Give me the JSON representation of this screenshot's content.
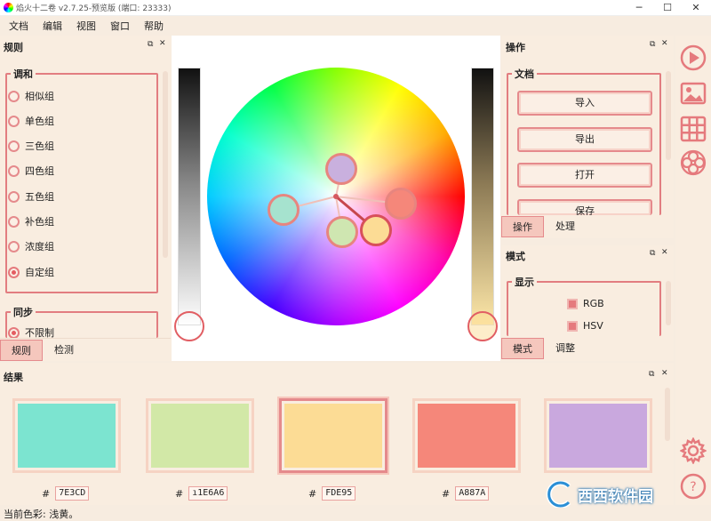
{
  "window": {
    "title": "焰火十二卷 v2.7.25-预览版 (端口: 23333)",
    "controls": [
      "─",
      "☐",
      "✕"
    ]
  },
  "menu": [
    "文档",
    "编辑",
    "视图",
    "窗口",
    "帮助"
  ],
  "rules_panel": {
    "title": "规则",
    "harmony_group_title": "调和",
    "harmony_options": [
      "相似组",
      "单色组",
      "三色组",
      "四色组",
      "五色组",
      "补色组",
      "浓度组",
      "自定组"
    ],
    "selected_option": "自定组",
    "sync_group_title": "同步",
    "sync_option": "不限制",
    "tabs": [
      "规则",
      "检测"
    ],
    "active_tab": "规则"
  },
  "operations_panel": {
    "title": "操作",
    "doc_group_title": "文档",
    "buttons": [
      "导入",
      "导出",
      "打开",
      "保存"
    ],
    "tabs": [
      "操作",
      "处理"
    ],
    "active_tab": "操作"
  },
  "mode_panel": {
    "title": "模式",
    "display_group_title": "显示",
    "checkboxes": [
      "RGB",
      "HSV"
    ],
    "tabs": [
      "模式",
      "调整"
    ],
    "active_tab": "模式"
  },
  "results_panel": {
    "title": "结果",
    "hash": "#",
    "swatches": [
      {
        "hex_shown": "7E3CD",
        "color": "#7ce4d0",
        "selected": false
      },
      {
        "hex_shown": "ı1E6A6",
        "color": "#d2e8a7",
        "selected": false
      },
      {
        "hex_shown": "FDE95",
        "color": "#fcdc95",
        "selected": true
      },
      {
        "hex_shown": "A887A",
        "color": "#f5877a",
        "selected": false
      },
      {
        "hex_shown": "",
        "color": "#c9a8de",
        "selected": false
      }
    ]
  },
  "status": {
    "text": "当前色彩: 浅黄。"
  },
  "wheel_dots": [
    {
      "color": "#c9b0de"
    },
    {
      "color": "#a6e3cf"
    },
    {
      "color": "#f5877a"
    },
    {
      "color": "#cfe6b1"
    },
    {
      "color": "#fcdc95"
    }
  ],
  "colors": {
    "accent": "#e58a8c",
    "panel_bg": "#f9ede0",
    "tab_active": "#f5c7bd"
  },
  "watermark": "西西软件园",
  "icons": {
    "toolbar": [
      "triangle-palette-icon",
      "image-icon",
      "grid-icon",
      "circles-icon"
    ],
    "settings": "gear-icon",
    "help": "help-icon"
  }
}
